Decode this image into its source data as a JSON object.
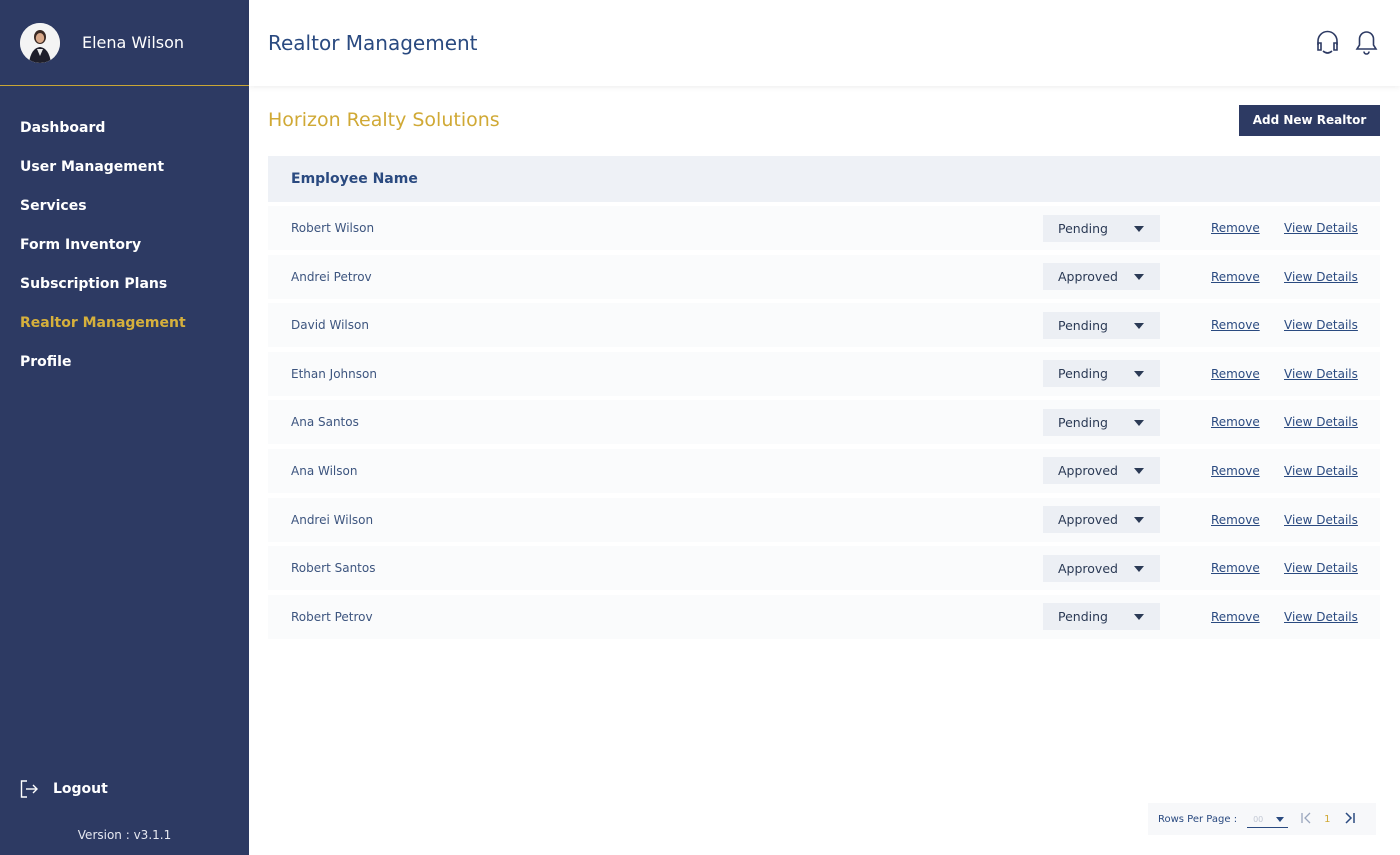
{
  "sidebar": {
    "user_name": "Elena Wilson",
    "items": [
      {
        "label": "Dashboard"
      },
      {
        "label": "User Management"
      },
      {
        "label": "Services"
      },
      {
        "label": "Form Inventory"
      },
      {
        "label": "Subscription Plans"
      },
      {
        "label": "Realtor Management"
      },
      {
        "label": "Profile"
      }
    ],
    "active_item": "Realtor Management",
    "logout_label": "Logout",
    "version": "Version : v3.1.1"
  },
  "header": {
    "title": "Realtor Management",
    "icons": [
      "support-chat-icon",
      "bell-icon"
    ]
  },
  "main": {
    "company_name": "Horizon Realty Solutions",
    "add_button_label": "Add New Realtor",
    "table": {
      "column_header": "Employee Name",
      "rows": [
        {
          "name": "Robert Wilson",
          "status": "Pending",
          "remove": "Remove",
          "details": "View Details"
        },
        {
          "name": "Andrei Petrov",
          "status": "Approved",
          "remove": "Remove",
          "details": "View Details"
        },
        {
          "name": "David Wilson",
          "status": "Pending",
          "remove": "Remove",
          "details": "View Details"
        },
        {
          "name": "Ethan Johnson",
          "status": "Pending",
          "remove": "Remove",
          "details": "View Details"
        },
        {
          "name": "Ana Santos",
          "status": "Pending",
          "remove": "Remove",
          "details": "View Details"
        },
        {
          "name": "Ana Wilson",
          "status": "Approved",
          "remove": "Remove",
          "details": "View Details"
        },
        {
          "name": "Andrei Wilson",
          "status": "Approved",
          "remove": "Remove",
          "details": "View Details"
        },
        {
          "name": "Robert Santos",
          "status": "Approved",
          "remove": "Remove",
          "details": "View Details"
        },
        {
          "name": "Robert Petrov",
          "status": "Pending",
          "remove": "Remove",
          "details": "View Details"
        }
      ]
    }
  },
  "pagination": {
    "rows_per_page_label": "Rows Per Page :",
    "rows_per_page_value": "00",
    "current_page": "1"
  },
  "colors": {
    "sidebar_bg": "#2d3a63",
    "accent_gold": "#d0a935",
    "primary_text": "#2a4a80"
  }
}
